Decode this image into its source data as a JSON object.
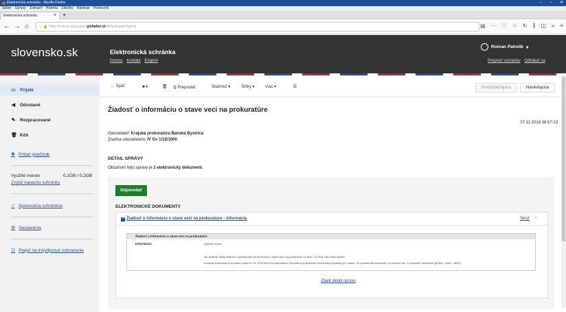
{
  "browser": {
    "window_title": "Elektronická schránka - Mozilla Firefox",
    "menu": [
      "Súbor",
      "Úpravy",
      "Zobraziť",
      "História",
      "Záložky",
      "Nástroje",
      "Pomocník"
    ],
    "tab_title": "Elektronická schránka",
    "url_prefix": "https://eslesk.vyvoj.upvs.",
    "url_domain": "globaltel.sk",
    "url_suffix": "/default.aspx?ng=sk"
  },
  "header": {
    "logo": "slovensko.sk",
    "app_title": "Elektronická schránka",
    "links": [
      "Pomoc",
      "Kontakt",
      "English"
    ],
    "user_name": "Roman Paholík",
    "user_links": [
      "Prepnúť schránku",
      "Odhlásiť sa"
    ]
  },
  "sidebar": {
    "inbox": "Prijaté",
    "sent": "Odoslané",
    "drafts": "Rozpracované",
    "trash": "Kôš",
    "add_folder": "Pridať priečinok",
    "storage_label": "Využité miesto",
    "storage_value": "0,1GB / 0,2GB",
    "increase_capacity": "Zvýšiť kapacitu schránky",
    "guide": "Sprievodca schránkou",
    "settings": "Nastavenia",
    "three_pane": "Prejsť na trojstĺpcové zobrazenie"
  },
  "toolbar": {
    "back": "← Späť",
    "forward": "Preposlať",
    "download": "Stiahnuť",
    "labels": "Štítky",
    "more": "Viac",
    "prev": "Predchádzajúca",
    "next": "Nasledujúca"
  },
  "message": {
    "title": "Žiadosť o informáciu o stave veci na prokuratúre",
    "date": "07.11.2018 08:57:13",
    "sender_label": "Odosielateľ:",
    "sender": "Krajská prokuratúra Banská Bystrica",
    "ref_label": "Značka odosielateľa:",
    "ref": "IV Gv 1/15/1000",
    "detail_heading": "DETAIL SPRÁVY",
    "content_prefix": "Obsahom tejto správy je",
    "content_count": "1 elektronický dokument",
    "reply": "Odpovedať",
    "docs_heading": "ELEKTRONICKÉ DOKUMENTY",
    "doc_title": "Žiadosť o informáciu o stave veci na prokuratúre - informácia",
    "hide": "Skryť",
    "show_detail": "Zbaliť detail správy"
  },
  "preview": {
    "heading": "Žiadosť o informáciu o stave veci na prokuratúre",
    "label": "Informácia:",
    "greeting": "Vážený občan,",
    "line1": "Na základe Vašej žiadosti o poskytnutie informovania o stave veci na prokuratúre zo dňa 7.3.2018 Vás informujeme:",
    "line2": "Konanie evidované pod číslom spisu IV Gv 1/15/1000 na prokuratúre Generálna prokuratúra Slovenskej republiky je v stave: TS pôsobnosti ukončené, po zrušení uzn. o vznesení obvinenia (§206/1, 194/1, 363/1)."
  }
}
